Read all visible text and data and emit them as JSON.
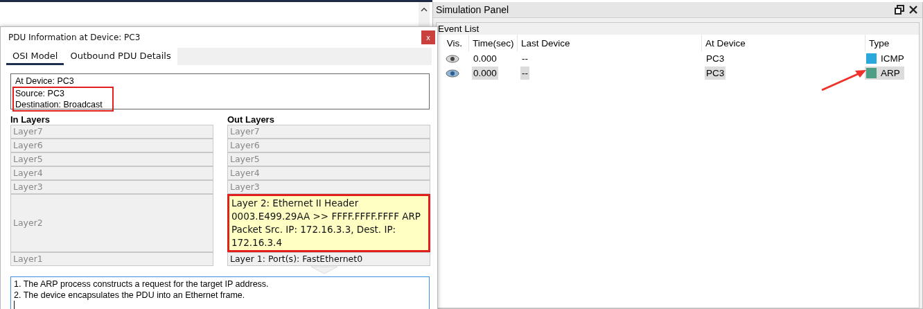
{
  "dialog": {
    "title": "PDU Information at Device: PC3",
    "close": "x",
    "tabs": [
      {
        "label": "OSI Model",
        "selected": true
      },
      {
        "label": "Outbound PDU Details",
        "selected": false
      }
    ],
    "info_lines": [
      {
        "text": "At Device: PC3",
        "highlighted": false
      },
      {
        "text": "Source: PC3",
        "highlighted": true
      },
      {
        "text": "Destination: Broadcast",
        "highlighted": true
      }
    ],
    "in_layers_heading": "In Layers",
    "out_layers_heading": "Out Layers",
    "in_layers": [
      {
        "text": "Layer7",
        "active": false,
        "highlighted": false
      },
      {
        "text": "Layer6",
        "active": false,
        "highlighted": false
      },
      {
        "text": "Layer5",
        "active": false,
        "highlighted": false
      },
      {
        "text": "Layer4",
        "active": false,
        "highlighted": false
      },
      {
        "text": "Layer3",
        "active": false,
        "highlighted": false
      },
      {
        "text": "Layer2",
        "active": false,
        "highlighted": false
      },
      {
        "text": "Layer1",
        "active": false,
        "highlighted": false
      }
    ],
    "out_layers": [
      {
        "text": "Layer7",
        "active": false,
        "highlighted": false
      },
      {
        "text": "Layer6",
        "active": false,
        "highlighted": false
      },
      {
        "text": "Layer5",
        "active": false,
        "highlighted": false
      },
      {
        "text": "Layer4",
        "active": false,
        "highlighted": false
      },
      {
        "text": "Layer3",
        "active": false,
        "highlighted": false
      },
      {
        "text": "Layer 2: Ethernet II Header 0003.E499.29AA >> FFFF.FFFF.FFFF ARP Packet Src. IP: 172.16.3.3, Dest. IP: 172.16.3.4",
        "active": true,
        "highlighted": true
      },
      {
        "text": "Layer 1: Port(s): FastEthernet0",
        "active": true,
        "highlighted": false
      }
    ],
    "description_lines": [
      "1. The ARP process constructs a request for the target IP address.",
      "2. The device encapsulates the PDU into an Ethernet frame."
    ]
  },
  "simulation_panel": {
    "title": "Simulation Panel",
    "event_list_label": "Event List",
    "columns": [
      "Vis.",
      "Time(sec)",
      "Last Device",
      "At Device",
      "Type"
    ],
    "rows": [
      {
        "time": "0.000",
        "last_device": "--",
        "at_device": "PC3",
        "type": "ICMP",
        "color": "#2aa8dc",
        "selected": false
      },
      {
        "time": "0.000",
        "last_device": "--",
        "at_device": "PC3",
        "type": "ARP",
        "color": "#4e9e86",
        "selected": true
      }
    ]
  }
}
